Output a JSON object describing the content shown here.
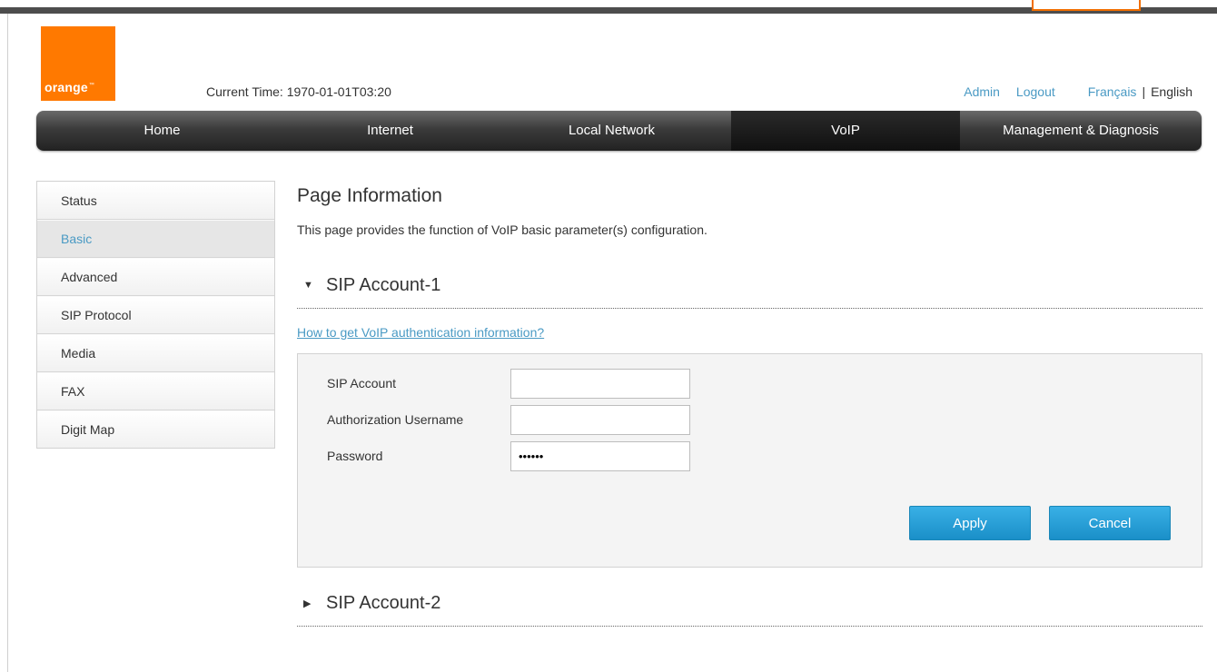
{
  "header": {
    "logo_text": "orange",
    "logo_tm": "™",
    "current_time": "Current Time: 1970-01-01T03:20",
    "links": {
      "admin": "Admin",
      "logout": "Logout",
      "french": "Français",
      "separator": "|",
      "english": "English"
    }
  },
  "nav": {
    "items": [
      {
        "label": "Home"
      },
      {
        "label": "Internet"
      },
      {
        "label": "Local Network"
      },
      {
        "label": "VoIP"
      },
      {
        "label": "Management & Diagnosis"
      }
    ],
    "active": "VoIP"
  },
  "sidebar": {
    "items": [
      {
        "label": "Status"
      },
      {
        "label": "Basic"
      },
      {
        "label": "Advanced"
      },
      {
        "label": "SIP Protocol"
      },
      {
        "label": "Media"
      },
      {
        "label": "FAX"
      },
      {
        "label": "Digit Map"
      }
    ],
    "active": "Basic"
  },
  "page": {
    "title": "Page Information",
    "description": "This page provides the function of VoIP basic parameter(s) configuration."
  },
  "sections": [
    {
      "arrow": "▼",
      "title": "SIP Account-1",
      "expanded": true
    },
    {
      "arrow": "▶",
      "title": "SIP Account-2",
      "expanded": false
    }
  ],
  "help_link": "How to get VoIP authentication information?",
  "form": {
    "fields": [
      {
        "label": "SIP Account",
        "value": ""
      },
      {
        "label": "Authorization Username",
        "value": ""
      },
      {
        "label": "Password",
        "value": "••••••"
      }
    ],
    "apply_label": "Apply",
    "cancel_label": "Cancel"
  },
  "colors": {
    "brand": "#ff7900",
    "link": "#4a9ac4",
    "button": "#1a8fc8"
  }
}
